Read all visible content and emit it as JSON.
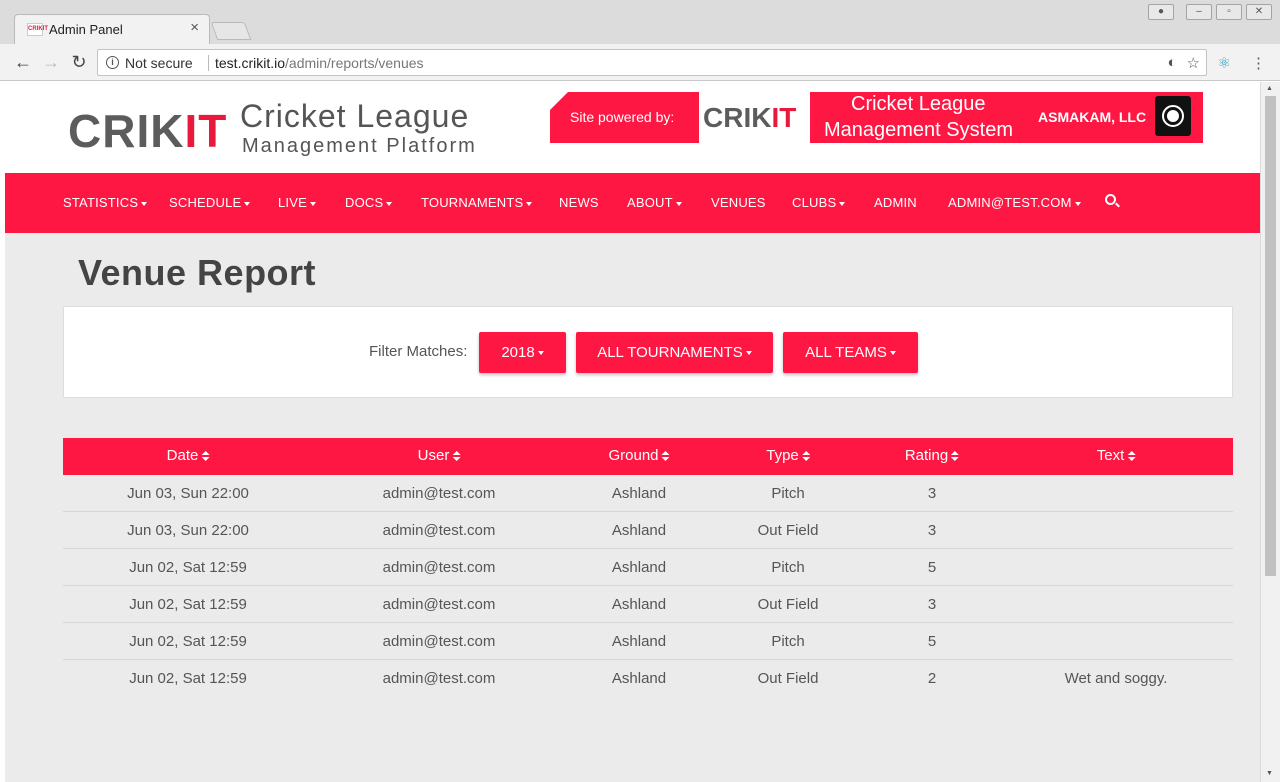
{
  "browser": {
    "tab_title": "Admin Panel",
    "tab_close": "×",
    "security_label": "Not secure",
    "url_host": "test.crikit.io",
    "url_path": "/admin/reports/venues"
  },
  "header": {
    "logo_cri": "CRIK",
    "logo_it": "IT",
    "logo_title": "Cricket League",
    "logo_subtitle": "Management Platform",
    "banner_powered": "Site powered by:",
    "banner_line1": "Cricket League",
    "banner_line2": "Management System",
    "banner_company": "ASMAKAM, LLC"
  },
  "nav": {
    "statistics": "STATISTICS",
    "schedule": "SCHEDULE",
    "live": "LIVE",
    "docs": "DOCS",
    "tournaments": "TOURNAMENTS",
    "news": "NEWS",
    "about": "ABOUT",
    "venues": "VENUES",
    "clubs": "CLUBS",
    "admin": "ADMIN",
    "account": "ADMIN@TEST.COM"
  },
  "page": {
    "title": "Venue Report",
    "filter_label": "Filter Matches:",
    "filter_year": "2018",
    "filter_tournaments": "ALL TOURNAMENTS",
    "filter_teams": "ALL TEAMS"
  },
  "table": {
    "headers": {
      "date": "Date",
      "user": "User",
      "ground": "Ground",
      "type": "Type",
      "rating": "Rating",
      "text": "Text"
    },
    "rows": [
      {
        "date": "Jun 03, Sun 22:00",
        "user": "admin@test.com",
        "ground": "Ashland",
        "type": "Pitch",
        "rating": "3",
        "text": ""
      },
      {
        "date": "Jun 03, Sun 22:00",
        "user": "admin@test.com",
        "ground": "Ashland",
        "type": "Out Field",
        "rating": "3",
        "text": ""
      },
      {
        "date": "Jun 02, Sat 12:59",
        "user": "admin@test.com",
        "ground": "Ashland",
        "type": "Pitch",
        "rating": "5",
        "text": ""
      },
      {
        "date": "Jun 02, Sat 12:59",
        "user": "admin@test.com",
        "ground": "Ashland",
        "type": "Out Field",
        "rating": "3",
        "text": ""
      },
      {
        "date": "Jun 02, Sat 12:59",
        "user": "admin@test.com",
        "ground": "Ashland",
        "type": "Pitch",
        "rating": "5",
        "text": ""
      },
      {
        "date": "Jun 02, Sat 12:59",
        "user": "admin@test.com",
        "ground": "Ashland",
        "type": "Out Field",
        "rating": "2",
        "text": "Wet and soggy."
      }
    ]
  },
  "colors": {
    "brand": "#ff1744",
    "page_bg": "#ebebeb"
  }
}
